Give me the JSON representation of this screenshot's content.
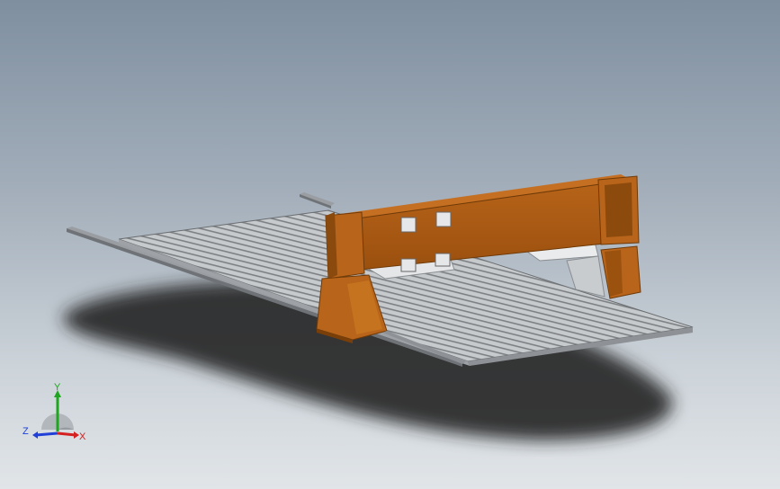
{
  "viewport": {
    "background_top": "#7f8fa0",
    "background_bottom": "#e1e5e8"
  },
  "model": {
    "frame_color": "#a65a12",
    "grating_color": "#b9bcbf",
    "rail_color": "#8f9397"
  },
  "triad": {
    "x_label": "X",
    "y_label": "Y",
    "z_label": "Z",
    "x_color": "#d42020",
    "y_color": "#1fa51f",
    "z_color": "#2040d8"
  }
}
